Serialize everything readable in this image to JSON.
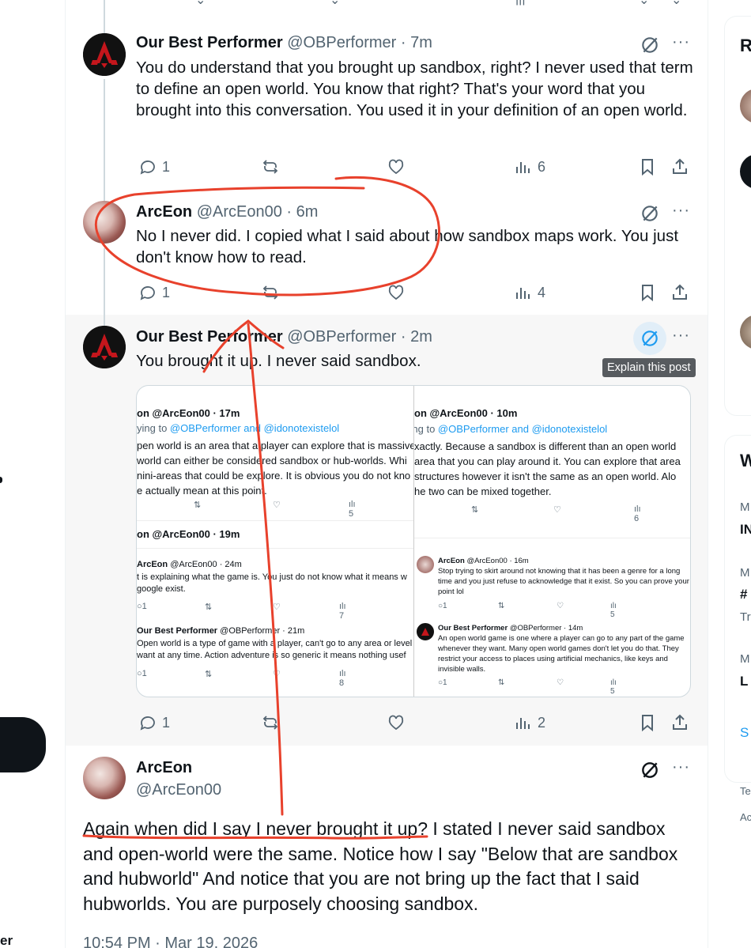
{
  "tweets": [
    {
      "name": "Our Best Performer",
      "handle": "@OBPerformer",
      "time": "· 7m",
      "text": "You do understand that you brought up sandbox, right? I never used that term to define an open world. You know that right? That's your word that you brought into this conversation. You used it in your definition of an open world.",
      "replies": "1",
      "views": "6"
    },
    {
      "name": "ArcEon",
      "handle": "@ArcEon00",
      "time": "· 6m",
      "text": "No I never did. I copied what I said about how sandbox maps work. You just don't know how to read.",
      "replies": "1",
      "views": "4"
    },
    {
      "name": "Our Best Performer",
      "handle": "@OBPerformer",
      "time": "· 2m",
      "text": "You brought it up. I never said sandbox.",
      "replies": "1",
      "views": "2",
      "tooltip": "Explain this post"
    }
  ],
  "embed": {
    "left": {
      "t1_head": "on @ArcEon00 · 17m",
      "t1_reply_prefix": "ying to ",
      "t1_reply_mentions": "@OBPerformer and @idonotexistelol",
      "t1_l1": "pen world is an area that a player can explore that is massive",
      "t1_l2": "world can either be considered sandbox or hub-worlds. Whi",
      "t1_l3": "nini-areas that could be explore. It is obvious you do not kno",
      "t1_l4": "e actually mean at this point.",
      "t1_views": "5",
      "t2_head": "on @ArcEon00 · 19m",
      "t3_name": "ArcEon",
      "t3_handle": "@ArcEon00 · 24m",
      "t3_l1": "t is explaining what the game is. You just do not know what it means w",
      "t3_l2": "google exist.",
      "t3_replies": "1",
      "t3_views": "7",
      "t4_name": "Our Best Performer",
      "t4_handle": "@OBPerformer · 21m",
      "t4_l1": "Open world is a type of game with a player, can't go to any area or level",
      "t4_l2": "want at any time. Action adventure is so generic it means nothing usef",
      "t4_replies": "1",
      "t4_views": "8"
    },
    "right": {
      "t1_head": "on @ArcEon00 · 10m",
      "t1_reply_prefix": "ying to ",
      "t1_reply_mentions": "@OBPerformer and @idonotexistelol",
      "t1_l1": "xactly. Because a sandbox is different than an open world",
      "t1_l2": "area that you can play around it. You can explore that area",
      "t1_l3": "structures however it isn't the same as an open world. Alo",
      "t1_l4": "he two can be mixed together.",
      "t1_views": "6",
      "t2_name": "ArcEon",
      "t2_handle": "@ArcEon00 · 16m",
      "t2_l1": "Stop trying to skirt around not knowing that it has been a genre for a long",
      "t2_l2": "time and you just refuse to acknowledge that it exist. So you can prove your",
      "t2_l3": "point lol",
      "t2_replies": "1",
      "t2_views": "5",
      "t3_name": "Our Best Performer",
      "t3_handle": "@OBPerformer · 14m",
      "t3_l1": "An open world game is one where a player can go to any part of the game",
      "t3_l2": "whenever they want. Many open world games don't let you do that. They",
      "t3_l3": "restrict your access to places using artificial mechanics, like keys and",
      "t3_l4": "invisible walls.",
      "t3_replies": "1",
      "t3_views": "5"
    }
  },
  "main_post": {
    "name": "ArcEon",
    "handle": "@ArcEon00",
    "text": "Again when did I say I never brought it up? I stated I never said sandbox and open-world were the same. Notice how I say \"Below that are sandbox and hubworld\" And notice that you are not bring up the fact that I said hubworlds. You are purposely choosing sandbox.",
    "timestamp": "10:54 PM · Mar 19, 2026"
  },
  "left_sidebar": {
    "bottom_fragment": "er"
  },
  "right_sidebar": {
    "heading_fragment": "R",
    "trends_heading_fragment": "W",
    "items": [
      "M",
      "IN",
      "M",
      "#",
      "Tr",
      "M",
      "L"
    ],
    "show_more_fragment": "S",
    "footer": [
      "Te",
      "Ac"
    ]
  },
  "colors": {
    "annotation_red": "#e8412c",
    "link_blue": "#1d9bf0",
    "text_gray": "#536471",
    "highlight_bg": "#f7f7f7"
  }
}
